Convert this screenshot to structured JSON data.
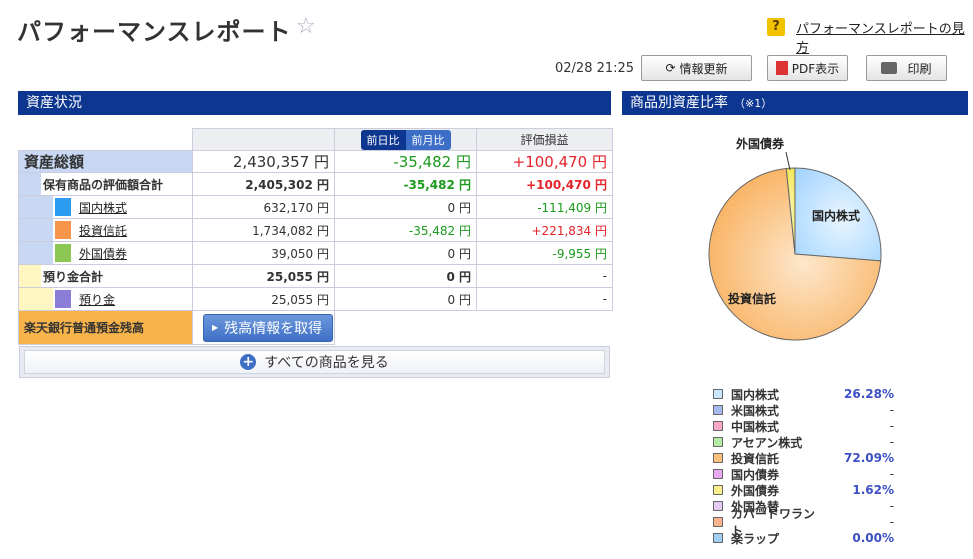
{
  "header": {
    "title": "パフォーマンスレポート",
    "help_link": "パフォーマンスレポートの見方",
    "help_icon": "?",
    "timestamp": "02/28 21:25"
  },
  "toolbar": {
    "refresh_label": "情報更新",
    "pdf_label": "PDF表示",
    "print_label": "印刷",
    "pdf_icon_text": "PDF"
  },
  "assets": {
    "section_title": "資産状況",
    "toggle": {
      "day": "前日比",
      "month": "前月比"
    },
    "col_eval": "評価損益",
    "total": {
      "label": "資産総額",
      "value": "2,430,357 円",
      "change": "-35,482 円",
      "profit": "+100,470 円"
    },
    "holdings": {
      "label": "保有商品の評価額合計",
      "value": "2,405,302 円",
      "change": "-35,482 円",
      "profit": "+100,470 円"
    },
    "items": [
      {
        "label": "国内株式",
        "value": "632,170 円",
        "change": "0 円",
        "profit": "-111,409 円",
        "color": "#2b9cf0"
      },
      {
        "label": "投資信託",
        "value": "1,734,082 円",
        "change": "-35,482 円",
        "profit": "+221,834 円",
        "color": "#f7964a"
      },
      {
        "label": "外国債券",
        "value": "39,050 円",
        "change": "0 円",
        "profit": "-9,955 円",
        "color": "#8cc653"
      }
    ],
    "deposit_total": {
      "label": "預り金合計",
      "value": "25,055 円",
      "change": "0 円",
      "profit": "-"
    },
    "deposit": {
      "label": "預り金",
      "value": "25,055 円",
      "change": "0 円",
      "profit": "-",
      "color": "#8a7ed8"
    },
    "bank": {
      "label": "楽天銀行普通預金残高",
      "button": "残高情報を取得"
    },
    "all_button": "すべての商品を見る"
  },
  "ratio": {
    "section_title": "商品別資産比率",
    "note": "（※1）",
    "pie_labels": {
      "domestic": "国内株式",
      "funds": "投資信託",
      "foreign_bond": "外国債券"
    },
    "legend": [
      {
        "name": "国内株式",
        "pct": "26.28%",
        "color": "#c7e6ff"
      },
      {
        "name": "米国株式",
        "pct": "-",
        "color": "#a9b8f0"
      },
      {
        "name": "中国株式",
        "pct": "-",
        "color": "#f7a8c8"
      },
      {
        "name": "アセアン株式",
        "pct": "-",
        "color": "#b5eca4"
      },
      {
        "name": "投資信託",
        "pct": "72.09%",
        "color": "#fbbf7c"
      },
      {
        "name": "国内債券",
        "pct": "-",
        "color": "#e9a8f0"
      },
      {
        "name": "外国債券",
        "pct": "1.62%",
        "color": "#f7f08a"
      },
      {
        "name": "外国為替",
        "pct": "-",
        "color": "#e6c8f7"
      },
      {
        "name": "カバードワラント",
        "pct": "-",
        "color": "#f6b38e"
      },
      {
        "name": "楽ラップ",
        "pct": "0.00%",
        "color": "#9fd0f4"
      }
    ]
  },
  "chart_data": {
    "type": "pie",
    "categories": [
      "国内株式",
      "投資信託",
      "外国債券",
      "楽ラップ"
    ],
    "values": [
      26.28,
      72.09,
      1.62,
      0.0
    ]
  }
}
